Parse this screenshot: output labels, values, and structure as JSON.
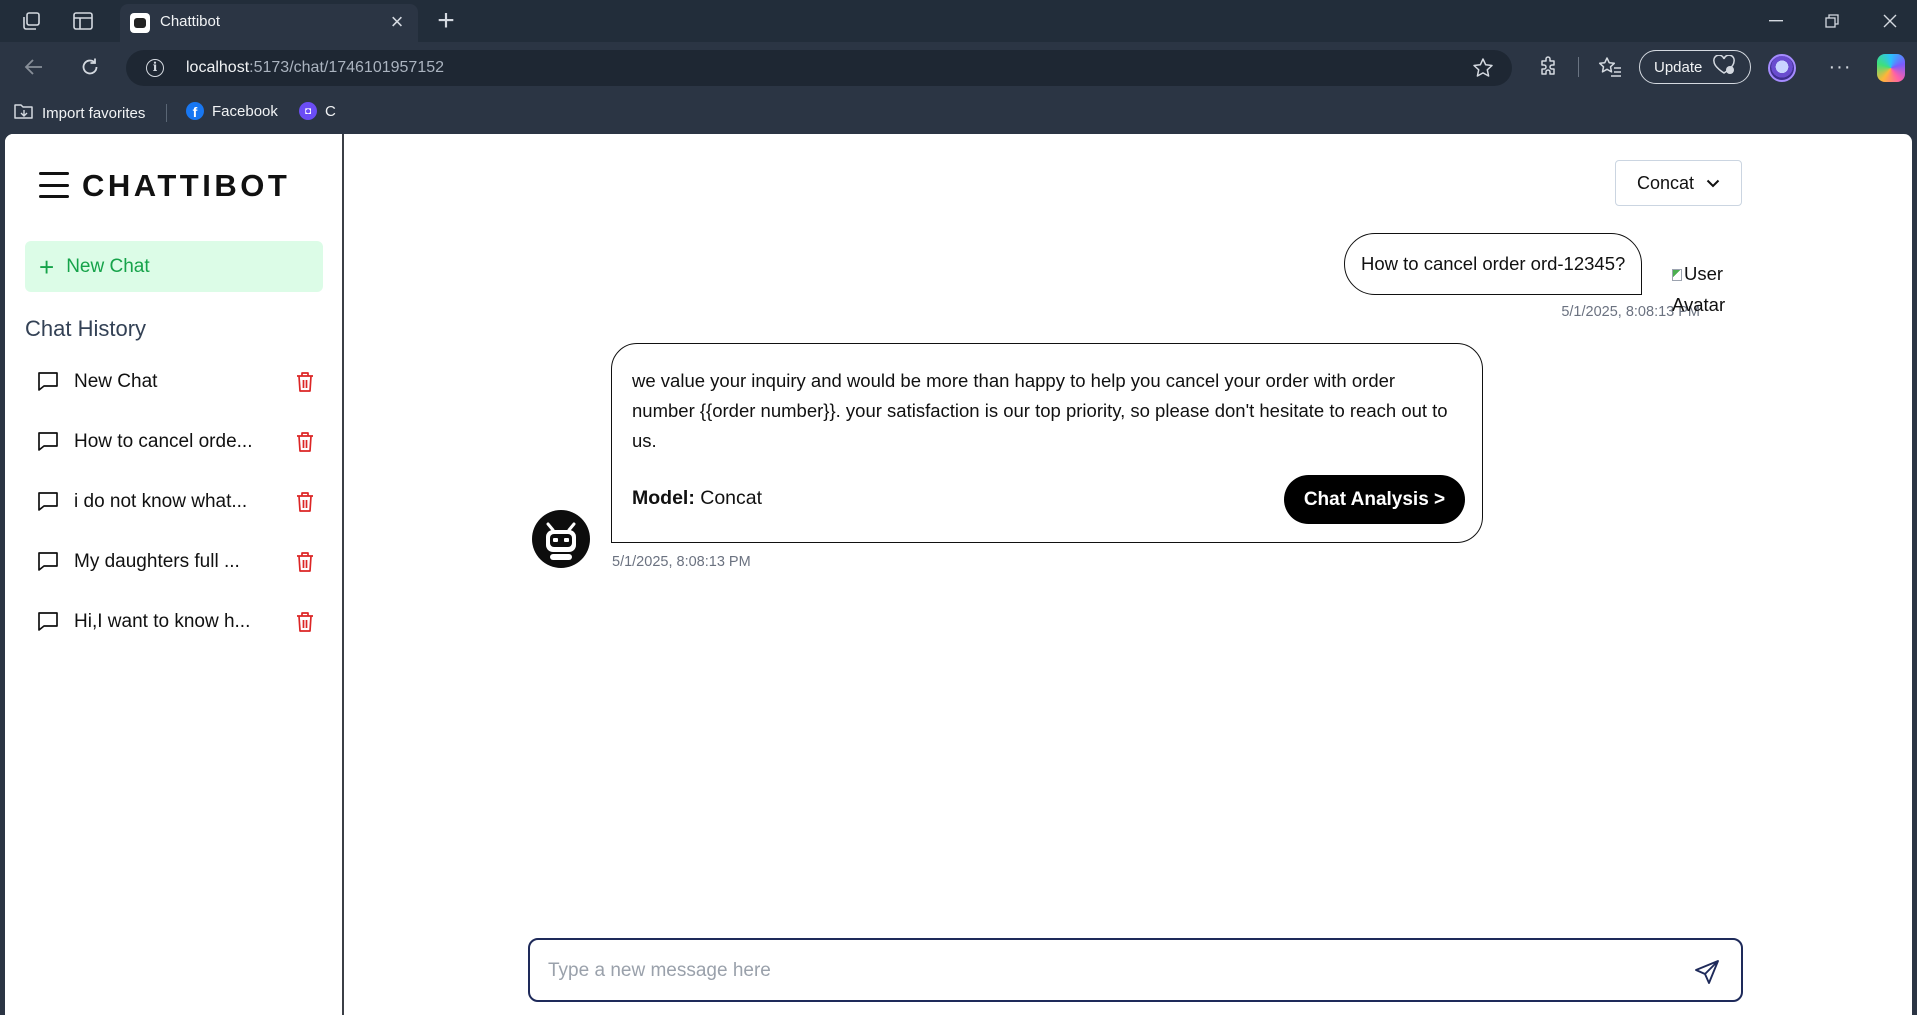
{
  "browser": {
    "tab_title": "Chattibot",
    "url_host": "localhost",
    "url_rest": ":5173/chat/1746101957152",
    "update_label": "Update",
    "bookmarks": [
      "Import favorites",
      "Facebook",
      "C"
    ]
  },
  "sidebar": {
    "brand": "CHATTIBOT",
    "new_chat_label": "New Chat",
    "history_title": "Chat History",
    "history": [
      {
        "label": "New Chat"
      },
      {
        "label": "How to cancel orde..."
      },
      {
        "label": "i do not know what..."
      },
      {
        "label": "My daughters full ..."
      },
      {
        "label": "Hi,I want to know h..."
      }
    ]
  },
  "main": {
    "model_select": "Concat",
    "messages": [
      {
        "role": "user",
        "text": "How to cancel order ord-12345?",
        "time": "5/1/2025, 8:08:13 PM",
        "avatar_alt": "User Avatar"
      },
      {
        "role": "bot",
        "text": "we value your inquiry and would be more than happy to help you cancel your order with order number {{order number}}. your satisfaction is our top priority, so please don't hesitate to reach out to us.",
        "model_label": "Model:",
        "model_value": "Concat",
        "analysis_button": "Chat Analysis >",
        "time": "5/1/2025, 8:08:13 PM"
      }
    ],
    "composer_placeholder": "Type a new message here"
  },
  "colors": {
    "accent_green": "#16a34a",
    "new_chat_bg": "#dcfce7",
    "delete_red": "#dc2626",
    "composer_border": "#1e2a5a"
  }
}
